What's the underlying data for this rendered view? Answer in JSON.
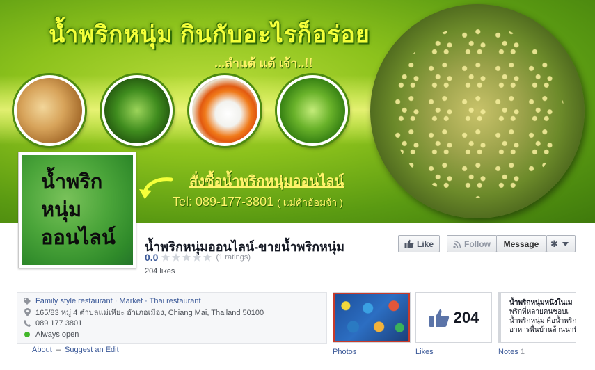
{
  "cover": {
    "title": "น้ำพริกหนุ่ม กินกับอะไรก็อร่อย",
    "subtitle": "...ลำแต้ แต้ เจ้า..!!",
    "order_text": "สั่งซื้อน้ำพริกหนุ่มออนไลน์",
    "tel": "Tel: 089-177-3801",
    "tel_note": "( แม่ค้าอ้อมจ้า )"
  },
  "profile": {
    "line1": "น้ำพริก",
    "line2": "หนุ่ม",
    "line3": "ออนไลน์"
  },
  "page": {
    "name": "น้ำพริกหนุ่มออนไลน์-ขายน้ำพริกหนุ่ม",
    "rating_value": "0.0",
    "stars_filled": 0,
    "ratings_count": "(1 ratings)",
    "likes": "204 likes"
  },
  "buttons": {
    "like": "Like",
    "follow": "Follow",
    "message": "Message"
  },
  "about": {
    "category": "Family style restaurant · Market · Thai restaurant",
    "address": "165/83 หมู่ 4 ตำบลแม่เหียะ อำเภอเมือง, Chiang Mai, Thailand 50100",
    "phone": "089 177 3801",
    "hours": "Always open",
    "about_link": "About",
    "separator": "–",
    "suggest_link": "Suggest an Edit"
  },
  "apps": {
    "photos_label": "Photos",
    "likes_label": "Likes",
    "likes_count": "204",
    "notes_label": "Notes",
    "notes_count": "1",
    "notes_preview": [
      "น้ำพริกหนุ่มหนึ่งในเม",
      "พริกที่หลายคนชอบเ",
      "น้ำพริกหนุ่ม คือน้ำพริก",
      "อาหารพื้นบ้านล้านนาที่"
    ]
  },
  "colors": {
    "link": "#3b5998",
    "cover_text": "#f4ff3a",
    "open_status": "#42b72a"
  }
}
